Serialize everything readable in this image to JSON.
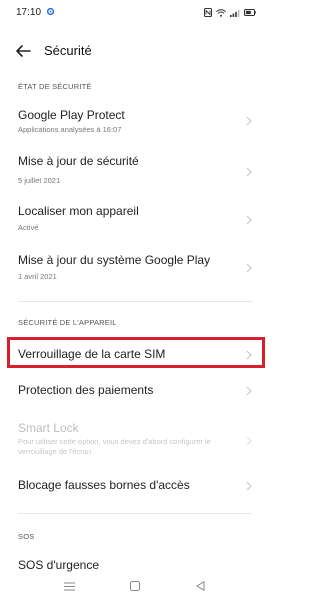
{
  "status_bar": {
    "time": "17:10"
  },
  "header": {
    "title": "Sécurité"
  },
  "sections": {
    "device_state": "ÉTAT DE SÉCURITÉ",
    "device_security": "SÉCURITÉ DE L'APPAREIL",
    "sos": "SOS"
  },
  "items": {
    "play_protect": {
      "title": "Google Play Protect",
      "subtitle": "Applications analysées à 16:07"
    },
    "security_update": {
      "title": "Mise à jour de sécurité",
      "subtitle": "5 juillet 2021"
    },
    "find_device": {
      "title": "Localiser mon appareil",
      "subtitle": "Activé"
    },
    "play_system_update": {
      "title": "Mise à jour du système Google Play",
      "subtitle": "1 avril 2021"
    },
    "sim_lock": {
      "title": "Verrouillage de la carte SIM"
    },
    "payment_protection": {
      "title": "Protection des paiements"
    },
    "smart_lock": {
      "title": "Smart Lock",
      "subtitle_line1": "Pour utiliser cette option, vous devez d'abord configurer le",
      "subtitle_line2": "verrouillage de l'écran"
    },
    "fake_base_station": {
      "title": "Blocage fausses bornes d'accès"
    },
    "emergency_sos": {
      "title": "SOS d'urgence"
    }
  },
  "colors": {
    "highlight_border": "#d81f2b",
    "disabled_text": "#bdbdbd"
  },
  "icons": [
    "gear-icon",
    "nfc-icon",
    "wifi-icon",
    "signal-icon",
    "battery-icon",
    "back-arrow-icon",
    "chevron-right-icon",
    "menu-icon",
    "home-icon",
    "back-triangle-icon"
  ]
}
